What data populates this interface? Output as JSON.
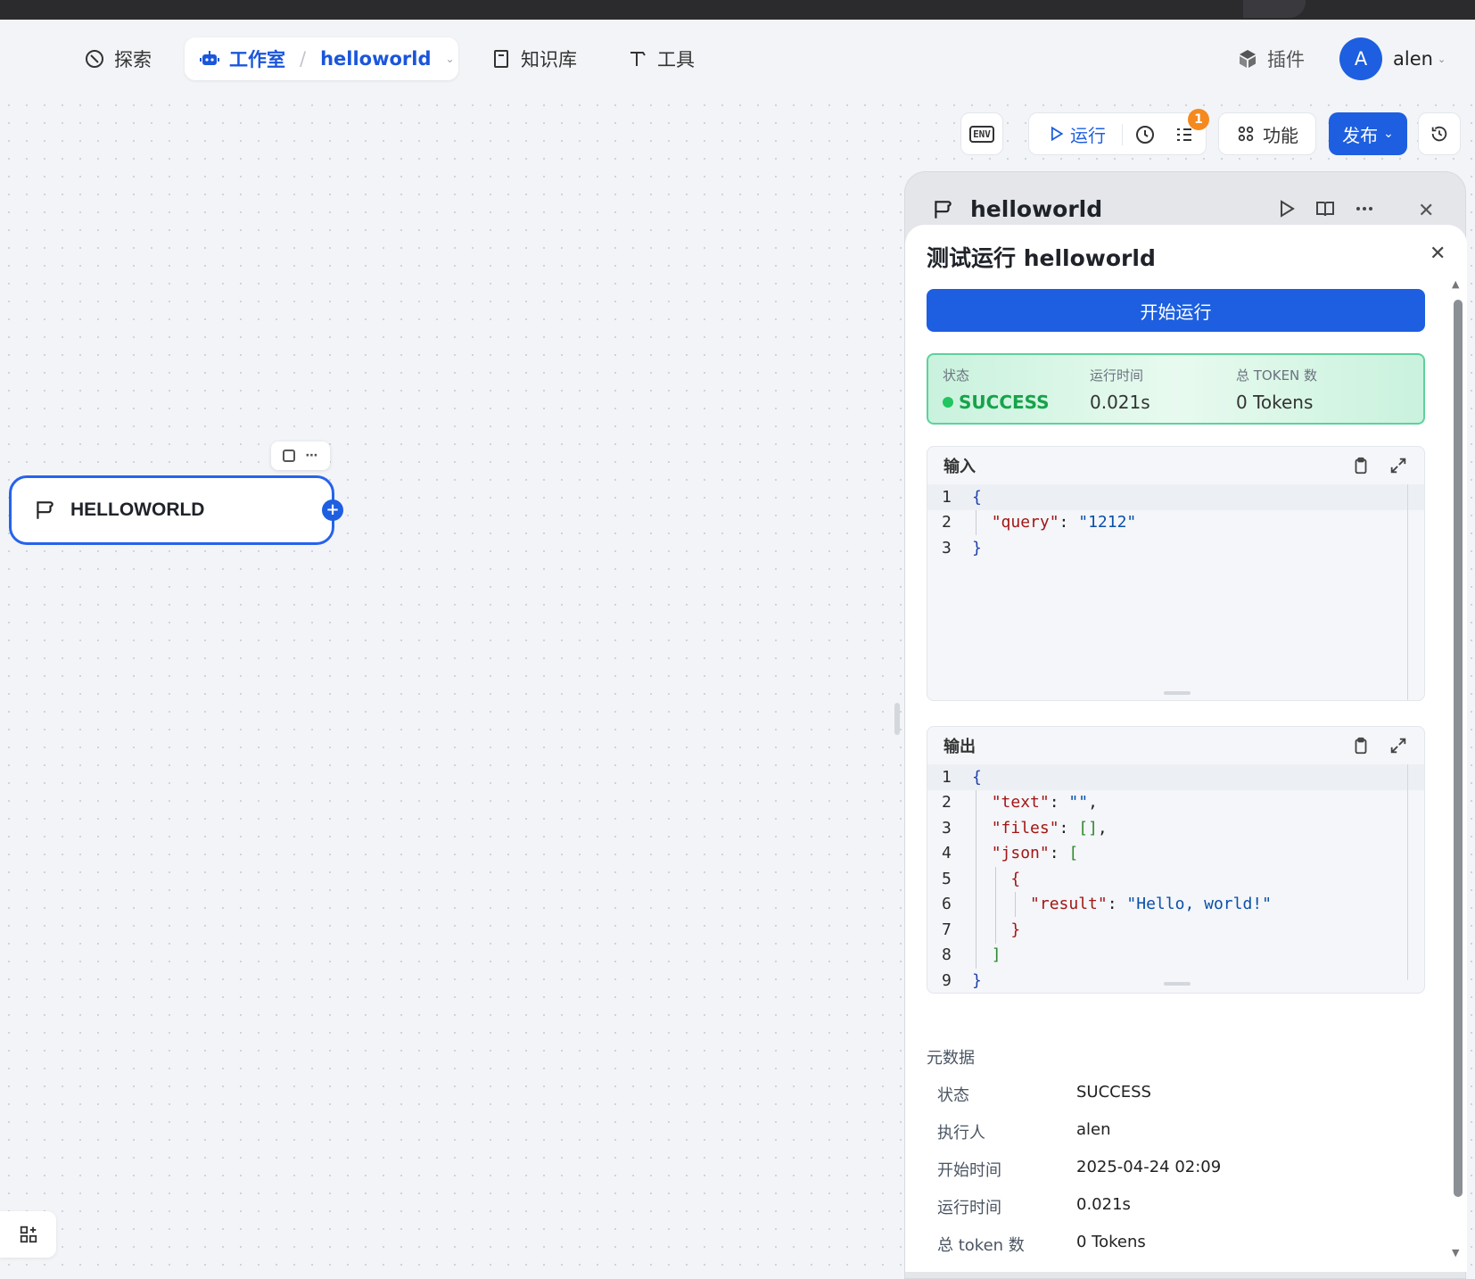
{
  "nav": {
    "explore": "探索",
    "studio": "工作室",
    "breadcrumb_sep": "/",
    "app_name": "helloworld",
    "knowledge": "知识库",
    "tools": "工具",
    "plugins": "插件",
    "avatar_letter": "A",
    "user": "alen"
  },
  "toolbar": {
    "env": "ENV",
    "run": "运行",
    "badge_count": "1",
    "features": "功能",
    "publish": "发布"
  },
  "canvas": {
    "node_title": "HELLOWORLD",
    "node_add": "+"
  },
  "panel_back": {
    "title": "helloworld"
  },
  "test_run": {
    "title": "测试运行 helloworld",
    "start_button": "开始运行",
    "stats": {
      "status_label": "状态",
      "status_value": "SUCCESS",
      "time_label": "运行时间",
      "time_value": "0.021s",
      "tokens_label": "总 TOKEN 数",
      "tokens_value": "0 Tokens"
    },
    "input": {
      "label": "输入",
      "lines": [
        "1",
        "2",
        "3"
      ]
    },
    "output": {
      "label": "输出",
      "lines": [
        "1",
        "2",
        "3",
        "4",
        "5",
        "6",
        "7",
        "8",
        "9"
      ]
    },
    "metadata": {
      "title": "元数据",
      "rows": [
        {
          "key": "状态",
          "value": "SUCCESS"
        },
        {
          "key": "执行人",
          "value": "alen"
        },
        {
          "key": "开始时间",
          "value": "2025-04-24 02:09"
        },
        {
          "key": "运行时间",
          "value": "0.021s"
        },
        {
          "key": "总 token 数",
          "value": "0 Tokens"
        }
      ]
    }
  },
  "code": {
    "brace_open": "{",
    "brace_close": "}",
    "query_key": "\"query\"",
    "query_val": "\"1212\"",
    "text_key": "\"text\"",
    "text_val": "\"\"",
    "files_key": "\"files\"",
    "files_val": "[]",
    "json_key": "\"json\"",
    "bracket_open": "[",
    "bracket_close": "]",
    "result_key": "\"result\"",
    "result_val": "\"Hello, world!\""
  },
  "colors": {
    "primary": "#1d5fe0",
    "success": "#16a34a",
    "badge": "#f5891f"
  }
}
